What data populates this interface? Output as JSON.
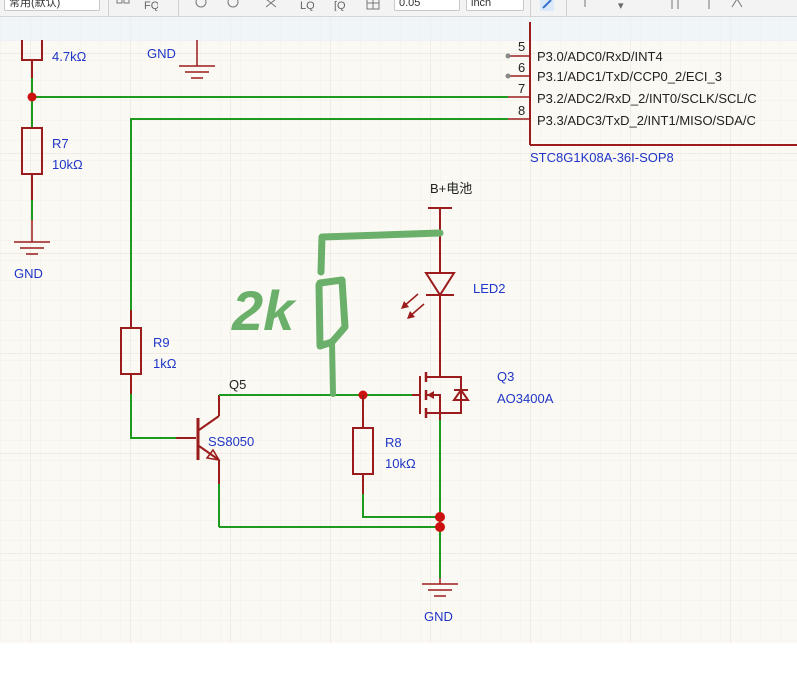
{
  "toolbar": {
    "units_combo": "常用(默认)",
    "grid_value": "0.05",
    "unit_value": "inch",
    "icons": [
      "grid-icon",
      "zoom-fit-icon",
      "zoom-in-icon",
      "zoom-out-icon",
      "fit-width-icon",
      "zoom-area-icon",
      "table-icon",
      "pen-icon",
      "layer-icon",
      "arrow-icon",
      "align-icon",
      "more-icon"
    ]
  },
  "schematic": {
    "ic": {
      "pins": [
        {
          "num": "5",
          "name": "P3.0/ADC0/RxD/INT4"
        },
        {
          "num": "6",
          "name": "P3.1/ADC1/TxD/CCP0_2/ECI_3"
        },
        {
          "num": "7",
          "name": "P3.2/ADC2/RxD_2/INT0/SCLK/SCL/C"
        },
        {
          "num": "8",
          "name": "P3.3/ADC3/TxD_2/INT1/MISO/SDA/C"
        }
      ],
      "part": "STC8G1K08A-36I-SOP8"
    },
    "r_top_value": "4.7kΩ",
    "gnd_top": "GND",
    "r7": {
      "ref": "R7",
      "value": "10kΩ"
    },
    "gnd_left": "GND",
    "battery": "B+电池",
    "led2": "LED2",
    "handwritten": "2k",
    "r9": {
      "ref": "R9",
      "value": "1kΩ"
    },
    "q5": {
      "ref": "Q5",
      "part": "SS8050"
    },
    "q3": {
      "ref": "Q3",
      "part": "AO3400A"
    },
    "r8": {
      "ref": "R8",
      "value": "10kΩ"
    },
    "gnd_bottom": "GND"
  },
  "colors": {
    "wire": "#1e9a1e",
    "component": "#9b1c1c",
    "label": "#1f36c8",
    "junction": "#cc1111",
    "grid": "#ece8de",
    "canvas": "#fbf9f3",
    "handwritten": "#6ab06a"
  }
}
